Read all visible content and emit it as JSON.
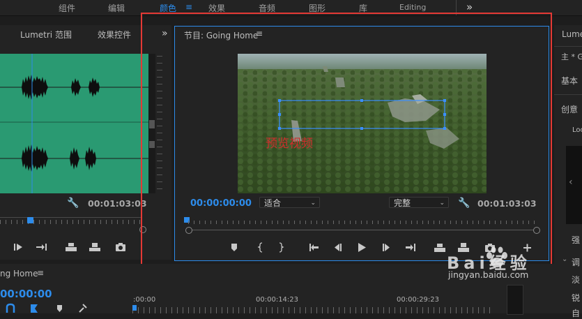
{
  "top_bar": {
    "tabs": [
      {
        "label": "组件",
        "active": false
      },
      {
        "label": "编辑",
        "active": false
      },
      {
        "label": "颜色",
        "active": true
      },
      {
        "label": "效果",
        "active": false
      },
      {
        "label": "音频",
        "active": false
      },
      {
        "label": "图形",
        "active": false
      },
      {
        "label": "库",
        "active": false
      },
      {
        "label": "Editing",
        "active": false
      }
    ],
    "more_glyph": "»"
  },
  "source_panel": {
    "tabs": [
      "Lumetri 范围",
      "效果控件"
    ],
    "more_glyph": "»",
    "timecode": "00:01:03:03"
  },
  "program_monitor": {
    "title": "节目: Going Home",
    "menu_glyph": "≡",
    "overlay_text": "预览视频",
    "current_timecode": "00:00:00:00",
    "zoom_select": "适合",
    "quality_select": "完整",
    "duration_timecode": "00:01:03:03"
  },
  "right_panel": {
    "header": "Lume",
    "rows": [
      "主 * G",
      "基本",
      "创意",
      "Loo",
      "强",
      "调",
      "淡",
      "锐",
      "自"
    ]
  },
  "timeline": {
    "title": "ng Home",
    "timecode": "00:00:00",
    "ruler_labels": [
      ":00:00",
      "00:00:14:23",
      "00:00:29:23"
    ]
  },
  "watermark": {
    "brand": "Bai经验",
    "url": "jingyan.baidu.com"
  },
  "colors": {
    "accent": "#2d8ceb",
    "highlight_box": "#e53935",
    "audio_track": "#2a9a72"
  }
}
